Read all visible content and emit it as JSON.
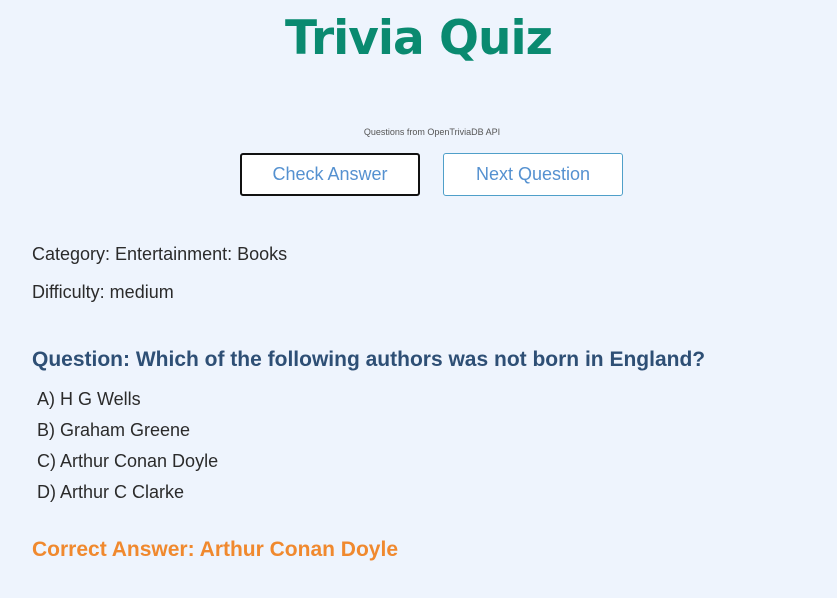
{
  "header": {
    "title": "Trivia Quiz",
    "subtitle": "Questions from OpenTriviaDB API"
  },
  "controls": {
    "check_label": "Check Answer",
    "next_label": "Next Question"
  },
  "info": {
    "category": "Category: Entertainment: Books",
    "difficulty": "Difficulty: medium"
  },
  "question": {
    "text": "Question: Which of the following authors was not born in England?",
    "options": [
      "A) H G Wells",
      "B) Graham Greene",
      "C) Arthur Conan Doyle",
      "D) Arthur C Clarke"
    ]
  },
  "result": {
    "correct_answer": "Correct Answer: Arthur Conan Doyle"
  },
  "colors": {
    "background": "#eef4fd",
    "title": "#0a8a70",
    "question": "#2e4f75",
    "answer": "#f0892e",
    "button_text": "#5591d0"
  }
}
